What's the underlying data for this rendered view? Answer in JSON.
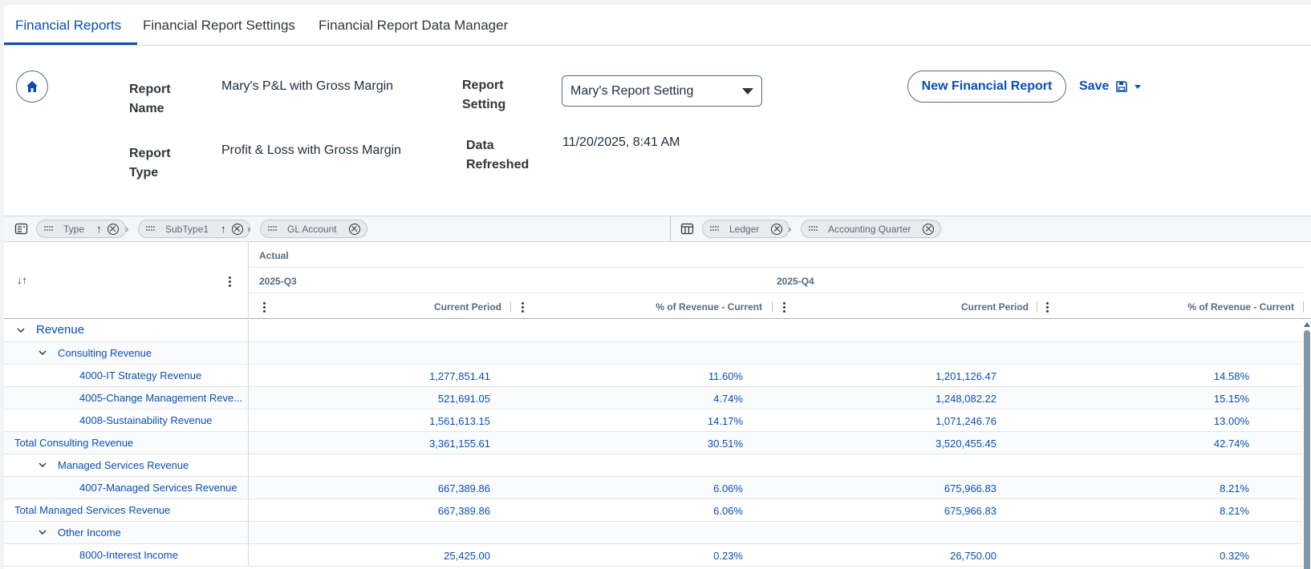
{
  "tabs": [
    {
      "label": "Financial Reports",
      "active": true
    },
    {
      "label": "Financial Report Settings",
      "active": false
    },
    {
      "label": "Financial Report Data Manager",
      "active": false
    }
  ],
  "header": {
    "report_name_label": "Report Name",
    "report_name_value": "Mary's P&L with Gross Margin",
    "report_type_label": "Report Type",
    "report_type_value": "Profit & Loss with Gross Margin",
    "report_setting_label": "Report Setting",
    "report_setting_value": "Mary's Report Setting",
    "data_refreshed_label": "Data Refreshed",
    "data_refreshed_value": "11/20/2025, 8:41 AM",
    "new_report_label": "New Financial Report",
    "save_label": "Save"
  },
  "row_dimensions": [
    {
      "label": "Type",
      "sort": "↑"
    },
    {
      "label": "SubType1",
      "sort": "↑"
    },
    {
      "label": "GL Account",
      "sort": ""
    }
  ],
  "column_dimensions": [
    {
      "label": "Ledger"
    },
    {
      "label": "Accounting Quarter"
    }
  ],
  "grid": {
    "sort_icon": "↓↑",
    "ledger": "Actual",
    "periods": [
      "2025-Q3",
      "2025-Q4"
    ],
    "measures": [
      "Current Period",
      "% of Revenue - Current",
      "Current Period",
      "% of Revenue - Current"
    ],
    "rows": [
      {
        "label": "Revenue",
        "level": 0,
        "expand": true,
        "values": [
          "",
          "",
          "",
          ""
        ]
      },
      {
        "label": "Consulting Revenue",
        "level": 1,
        "expand": true,
        "values": [
          "",
          "",
          "",
          ""
        ]
      },
      {
        "label": "4000-IT Strategy Revenue",
        "level": 2,
        "expand": false,
        "values": [
          "1,277,851.41",
          "11.60%",
          "1,201,126.47",
          "14.58%"
        ]
      },
      {
        "label": "4005-Change Management Reve...",
        "level": 2,
        "expand": false,
        "values": [
          "521,691.05",
          "4.74%",
          "1,248,082.22",
          "15.15%"
        ]
      },
      {
        "label": "4008-Sustainability Revenue",
        "level": 2,
        "expand": false,
        "values": [
          "1,561,613.15",
          "14.17%",
          "1,071,246.76",
          "13.00%"
        ]
      },
      {
        "label": "Total Consulting Revenue",
        "level": -1,
        "expand": false,
        "values": [
          "3,361,155.61",
          "30.51%",
          "3,520,455.45",
          "42.74%"
        ]
      },
      {
        "label": "Managed Services Revenue",
        "level": 1,
        "expand": true,
        "values": [
          "",
          "",
          "",
          ""
        ]
      },
      {
        "label": "4007-Managed Services Revenue",
        "level": 2,
        "expand": false,
        "values": [
          "667,389.86",
          "6.06%",
          "675,966.83",
          "8.21%"
        ]
      },
      {
        "label": "Total Managed Services Revenue",
        "level": -1,
        "expand": false,
        "values": [
          "667,389.86",
          "6.06%",
          "675,966.83",
          "8.21%"
        ]
      },
      {
        "label": "Other Income",
        "level": 1,
        "expand": true,
        "values": [
          "",
          "",
          "",
          ""
        ]
      },
      {
        "label": "8000-Interest Income",
        "level": 2,
        "expand": false,
        "values": [
          "25,425.00",
          "0.23%",
          "26,750.00",
          "0.32%"
        ]
      }
    ]
  },
  "colors": {
    "accent": "#0a4db4",
    "text": "#1d2d3e",
    "label": "#32363a",
    "muted": "#556b82"
  }
}
